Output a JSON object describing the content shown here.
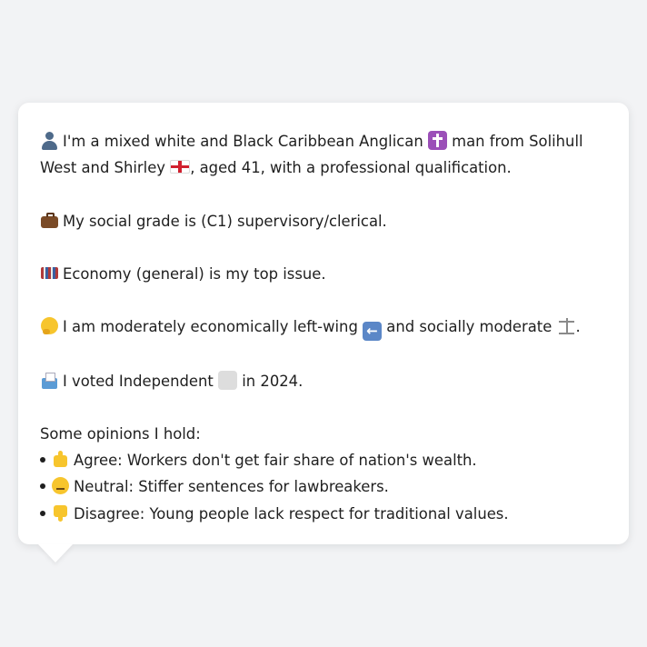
{
  "profile": {
    "identity_line1_pre": "I'm a mixed white and Black Caribbean Anglican",
    "identity_line1_post": "man from Solihull",
    "identity_line2_pre": "West and Shirley",
    "identity_line2_post": ", aged 41, with a professional qualification.",
    "social_grade": "My social grade is (C1) supervisory/clerical.",
    "top_issue": "Economy (general) is my top issue.",
    "ideology_pre": "I am moderately economically left-wing",
    "ideology_mid": "and socially moderate",
    "ideology_post": ".",
    "vote_pre": "I voted Independent",
    "vote_post": "in 2024.",
    "opinions_heading": "Some opinions I hold:",
    "opinions": [
      {
        "stance": "Agree",
        "text": "Workers don't get fair share of nation's wealth."
      },
      {
        "stance": "Neutral",
        "text": "Stiffer sentences for lawbreakers."
      },
      {
        "stance": "Disagree",
        "text": "Young people lack respect for traditional values."
      }
    ],
    "opinion_1_full": "Agree: Workers don't get fair share of nation's wealth.",
    "opinion_2_full": "Neutral: Stiffer sentences for lawbreakers.",
    "opinion_3_full": "Disagree: Young people lack respect for traditional values."
  },
  "icons": {
    "person": "person-icon",
    "religion": "latin-cross-icon",
    "flag": "england-flag-icon",
    "job": "briefcase-icon",
    "issue": "banknotes-icon",
    "thinking": "thinking-face-icon",
    "economic": "left-arrow-icon",
    "social": "balance-scale-icon",
    "vote": "ballot-box-icon",
    "party_colour": "grey-square-icon",
    "agree": "thumbs-up-icon",
    "neutral": "neutral-face-icon",
    "disagree": "thumbs-down-icon"
  },
  "colors": {
    "background": "#f2f3f5",
    "bubble": "#ffffff",
    "text": "#1f1f1f",
    "party_square": "#dddddd"
  }
}
